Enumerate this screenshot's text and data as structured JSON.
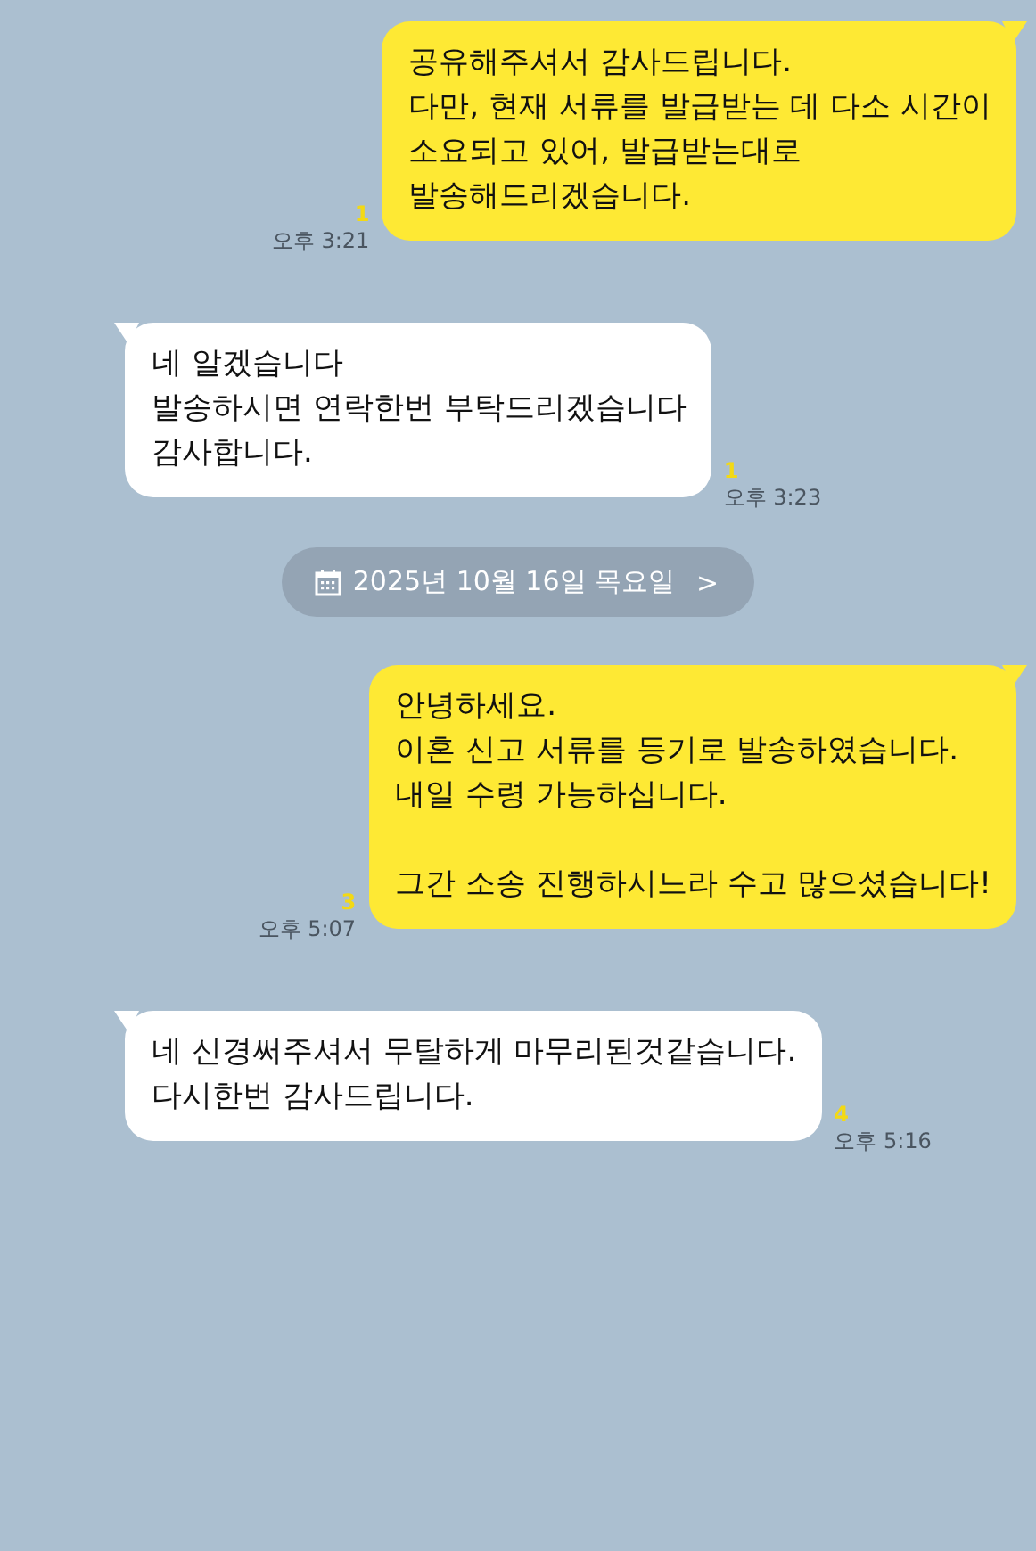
{
  "messages": [
    {
      "kind": "sent",
      "text": "공유해주셔서 감사드립니다.\n다만, 현재 서류를 발급받는 데 다소 시간이\n소요되고 있어, 발급받는대로\n발송해드리겠습니다.",
      "unread": "1",
      "time": "오후 3:21"
    },
    {
      "kind": "received",
      "text": "네 알겠습니다\n발송하시면 연락한번 부탁드리겠습니다\n감사합니다.",
      "unread": "1",
      "time": "오후 3:23"
    },
    {
      "kind": "date",
      "text": "2025년 10월 16일 목요일",
      "arrow": ">"
    },
    {
      "kind": "sent",
      "text": "안녕하세요.\n이혼 신고 서류를 등기로 발송하였습니다.\n내일 수령 가능하십니다.\n\n그간 소송 진행하시느라 수고 많으셨습니다!",
      "unread": "3",
      "time": "오후 5:07"
    },
    {
      "kind": "received",
      "text": "네 신경써주셔서 무탈하게 마무리된것같습니다.\n다시한번 감사드립니다.",
      "unread": "4",
      "time": "오후 5:16"
    }
  ]
}
